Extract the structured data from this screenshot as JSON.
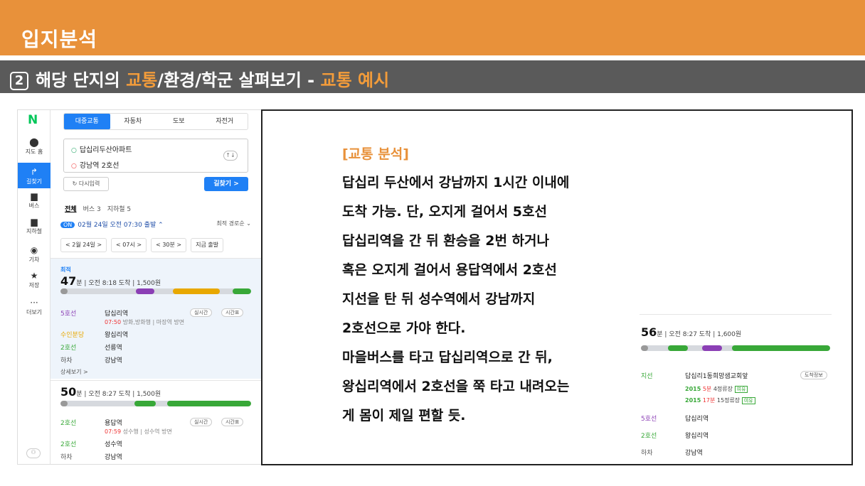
{
  "slide": {
    "section_title": "입지분석",
    "subtitle_num": "2",
    "subtitle_a": "해당 단지의 ",
    "subtitle_b": "교통",
    "subtitle_c": "/환경/학군 살펴보기 - ",
    "subtitle_d": "교통 예시"
  },
  "colors": {
    "banner": "#E8913A",
    "sub_banner": "#5a5a5a",
    "accent": "#F39C3A",
    "naver_blue": "#1F80F5",
    "line2": "#38A838",
    "line5": "#8B3FB5",
    "bus_yellow": "#E8A800"
  },
  "sidebar": {
    "logo": "N",
    "items": [
      {
        "icon": "pin-icon",
        "label": "지도 홈"
      },
      {
        "icon": "directions-icon",
        "label": "길찾기"
      },
      {
        "icon": "bus-icon",
        "label": "버스"
      },
      {
        "icon": "subway-icon",
        "label": "지하철"
      },
      {
        "icon": "train-icon",
        "label": "기차"
      },
      {
        "icon": "star-icon",
        "label": "저장"
      },
      {
        "icon": "more-icon",
        "label": "더보기"
      }
    ]
  },
  "modes": [
    "대중교통",
    "자동차",
    "도보",
    "자전거"
  ],
  "route": {
    "from": "답십리두산아파트",
    "to": "강남역 2호선",
    "swap": "↑↓",
    "reset": "다시입력",
    "search": "길찾기 >"
  },
  "filters": {
    "all": "전체",
    "bus": "버스 3",
    "subway": "지하철 5"
  },
  "depart": {
    "on": "ON",
    "text": "02월 24일 오전 07:30 출발",
    "sort": "최적 경로순"
  },
  "pickers": [
    "< 2월 24일 >",
    "< 07시 >",
    "< 30분 >",
    "지금 출발"
  ],
  "best": {
    "badge": "최적",
    "min": "47",
    "unit": "분",
    "rest": "| 오전 8:18 도착 | 1,500원",
    "bar": [
      "16분",
      "3분",
      "5분",
      "11분",
      "2분",
      "3분"
    ],
    "steps": [
      {
        "line": "5호선",
        "name": "답십리역",
        "color": "#8B3FB5"
      },
      {
        "line": "수인분당",
        "name": "왕십리역",
        "color": "#E8A800"
      },
      {
        "line": "2호선",
        "name": "선릉역",
        "color": "#38A838"
      },
      {
        "line": "하차",
        "name": "강남역",
        "color": "#555"
      }
    ],
    "sub_time": "07:50",
    "sub_text": " 방화,방화행 | 마장역 방면",
    "btn_rt": "실시간",
    "btn_tt": "시간표",
    "more": "상세보기 >"
  },
  "second": {
    "min": "50",
    "unit": "분",
    "rest": "| 오전 8:27 도착 | 1,500원",
    "bar": [
      "21분",
      "3분",
      "2분",
      "23분"
    ],
    "steps": [
      {
        "line": "2호선",
        "name": "용답역",
        "color": "#38A838"
      },
      {
        "line": "2호선",
        "name": "성수역",
        "color": "#38A838"
      },
      {
        "line": "하차",
        "name": "강남역",
        "color": "#555"
      }
    ],
    "sub_time": "07:59",
    "sub_text": " 성수행 | 성수역 방면",
    "btn_rt": "실시간",
    "btn_tt": "시간표"
  },
  "analysis": {
    "head": "[교통 분석]",
    "lines": [
      "답십리 두산에서 강남까지 1시간 이내에",
      "도착 가능. 단, 오지게 걸어서 5호선",
      "답십리역을 간 뒤 환승을 2번 하거나",
      "혹은 오지게 걸어서 용답역에서 2호선",
      "지선을 탄 뒤 성수역에서 강남까지",
      "2호선으로 가야 한다.",
      "마을버스를 타고 답십리역으로 간 뒤,",
      "왕십리역에서 2호선을 쭉 타고 내려오는",
      "게 몸이 제일 편할 듯."
    ]
  },
  "inset": {
    "min": "56",
    "unit": "분",
    "rest": "| 오전 8:27 도착 | 1,600원",
    "bar": [
      "6분",
      "4분",
      "4분",
      "3분",
      "3분",
      "29분"
    ],
    "stop_line": "지선",
    "stop_name": "답십리1동희망샘교회앞",
    "info": "도착정보",
    "buses": [
      {
        "no": "2015",
        "t": "5분",
        "s": "4정류장",
        "tag": "여유"
      },
      {
        "no": "2015",
        "t": "17분",
        "s": "15정류장",
        "tag": "여유"
      }
    ],
    "steps": [
      {
        "line": "5호선",
        "name": "답십리역",
        "color": "#8B3FB5"
      },
      {
        "line": "2호선",
        "name": "왕십리역",
        "color": "#38A838"
      },
      {
        "line": "하차",
        "name": "강남역",
        "color": "#555"
      }
    ]
  }
}
